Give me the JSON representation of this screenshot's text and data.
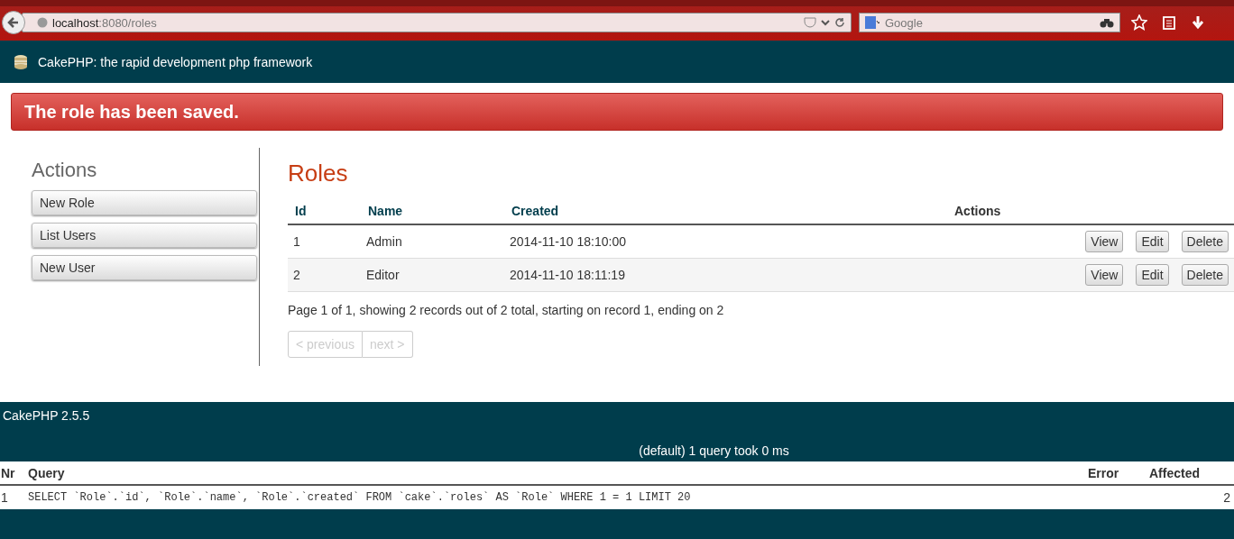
{
  "browser": {
    "url_host": "localhost",
    "url_rest": ":8080/roles",
    "search": {
      "placeholder": "Google"
    }
  },
  "header": {
    "title": "CakePHP: the rapid development php framework"
  },
  "flash": {
    "message": "The role has been saved."
  },
  "sidebar": {
    "heading": "Actions",
    "items": [
      "New Role",
      "List Users",
      "New User"
    ]
  },
  "main": {
    "title": "Roles",
    "columns": [
      "Id",
      "Name",
      "Created",
      "Actions"
    ],
    "rows": [
      {
        "id": "1",
        "name": "Admin",
        "created": "2014-11-10 18:10:00",
        "actions": [
          "View",
          "Edit",
          "Delete"
        ]
      },
      {
        "id": "2",
        "name": "Editor",
        "created": "2014-11-10 18:11:19",
        "actions": [
          "View",
          "Edit",
          "Delete"
        ]
      }
    ],
    "counter": "Page 1 of 1, showing 2 records out of 2 total, starting on record 1, ending on 2",
    "paging": [
      {
        "label": "< previous",
        "disabled": true
      },
      {
        "label": "next >",
        "disabled": true
      }
    ]
  },
  "footer": {
    "version": "CakePHP 2.5.5",
    "summary": "(default) 1 query took 0 ms",
    "columns": [
      "Nr",
      "Query",
      "Error",
      "Affected"
    ],
    "rows": [
      {
        "nr": "1",
        "query": "SELECT `Role`.`id`, `Role`.`name`, `Role`.`created` FROM `cake`.`roles` AS `Role` WHERE 1 = 1 LIMIT 20",
        "error": "",
        "affected": "2"
      }
    ]
  }
}
